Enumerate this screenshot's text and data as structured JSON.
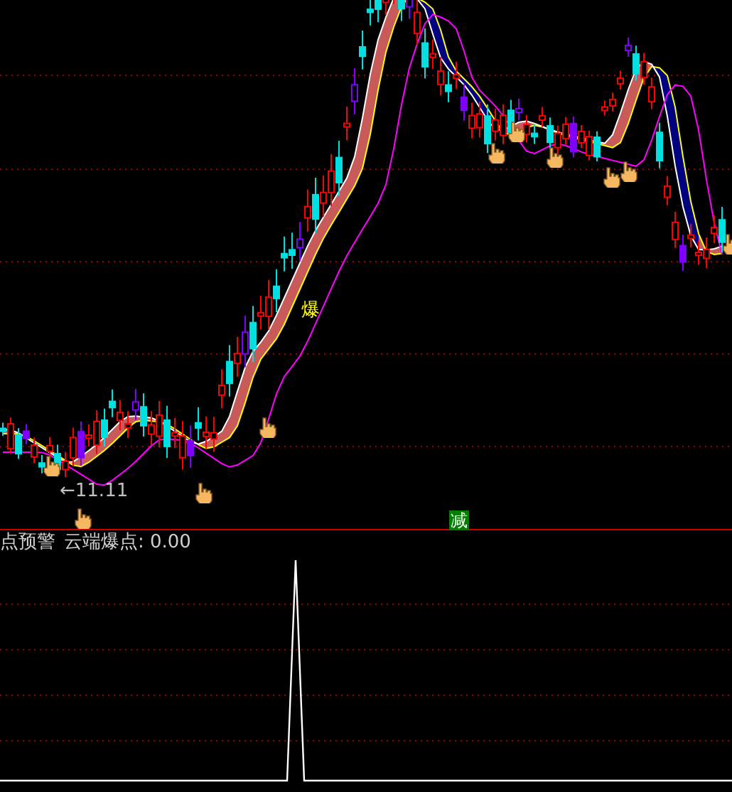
{
  "annotations": [
    {
      "kind": "price",
      "text": "←11.11"
    },
    {
      "kind": "signal",
      "text": "爆"
    },
    {
      "kind": "badge",
      "text": "减"
    }
  ],
  "indicator": {
    "title": "点预警",
    "label": "云端爆点: 0.00"
  }
}
